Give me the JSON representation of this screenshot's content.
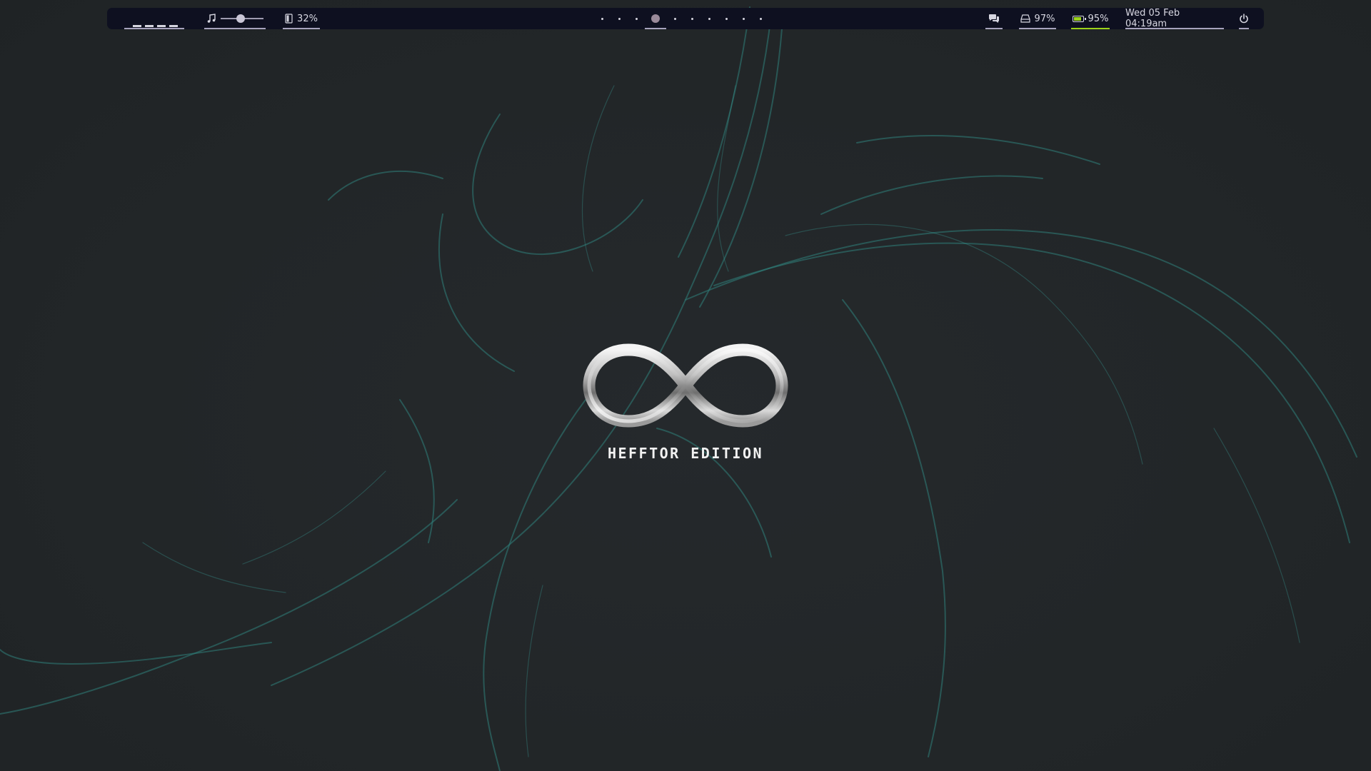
{
  "colors": {
    "bar_background": "#0e1020",
    "bar_text": "#d6d6e0",
    "underline": "#a7a3bd",
    "battery_accent": "#9bd21a",
    "active_workspace": "#9a8a9a",
    "desktop_background": "#232629",
    "swirl_accent": "#2f7f7a"
  },
  "topbar": {
    "taskbar": {
      "icon": "window-list-icon"
    },
    "volume": {
      "icon": "music-note-icon",
      "level": 0.45
    },
    "backlight": {
      "icon": "backlight-icon",
      "label": "32%"
    },
    "workspaces": {
      "count": 10,
      "active_index": 3
    },
    "chat": {
      "icon": "chat-bubbles-icon"
    },
    "disk": {
      "icon": "disk-drive-icon",
      "label": "97%"
    },
    "battery": {
      "icon": "battery-icon",
      "label": "95%",
      "level": 0.95
    },
    "clock": {
      "label": "Wed 05 Feb 04:19am"
    },
    "power": {
      "icon": "power-icon"
    }
  },
  "wallpaper": {
    "logo": {
      "icon": "infinity-logo-icon",
      "text": "HEFFTOR EDITION"
    }
  }
}
